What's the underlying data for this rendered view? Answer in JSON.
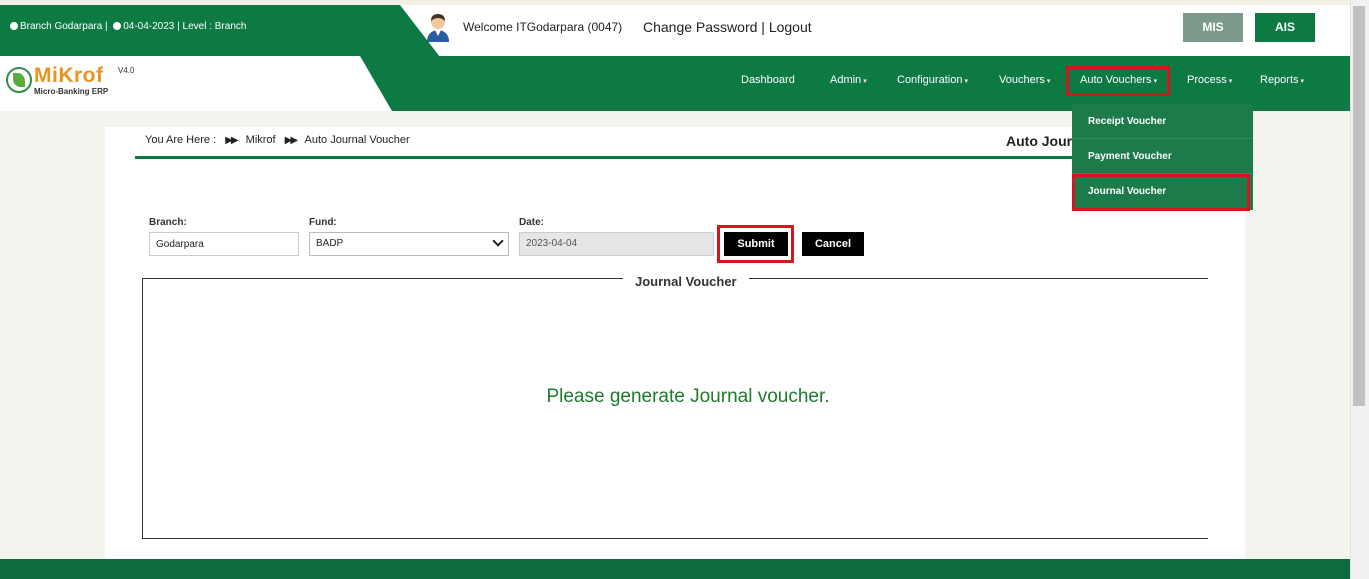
{
  "header": {
    "branch_info": "Branch Godarpara |",
    "date_level": "04-04-2023 | Level : Branch",
    "welcome": "Welcome ITGodarpara (0047)",
    "change_password": "Change Password",
    "separator": "|",
    "logout": "Logout",
    "mis_label": "MIS",
    "ais_label": "AIS"
  },
  "logo": {
    "name": "MiKrof",
    "version": "V4.0",
    "subtitle": "Micro-Banking ERP"
  },
  "nav": {
    "dashboard": "Dashboard",
    "admin": "Admin",
    "configuration": "Configuration",
    "vouchers": "Vouchers",
    "auto_vouchers": "Auto Vouchers",
    "process": "Process",
    "reports": "Reports"
  },
  "dropdown": {
    "items": [
      "Receipt Voucher",
      "Payment Voucher",
      "Journal Voucher"
    ]
  },
  "breadcrumb": {
    "prefix": "You Are Here  :",
    "level1": "Mikrof",
    "level2": "Auto Journal Voucher"
  },
  "page_title": "Auto Journal Voucher",
  "form": {
    "branch_label": "Branch:",
    "branch_value": "Godarpara",
    "fund_label": "Fund:",
    "fund_value": "BADP",
    "date_label": "Date:",
    "date_value": "2023-04-04",
    "submit_label": "Submit",
    "cancel_label": "Cancel"
  },
  "panel": {
    "legend": "Journal Voucher",
    "message": "Please generate Journal voucher."
  },
  "colors": {
    "brand_green": "#0d7a44",
    "highlight_red": "#d4151c",
    "message_green": "#1f7a2a",
    "logo_orange": "#e8941f"
  }
}
